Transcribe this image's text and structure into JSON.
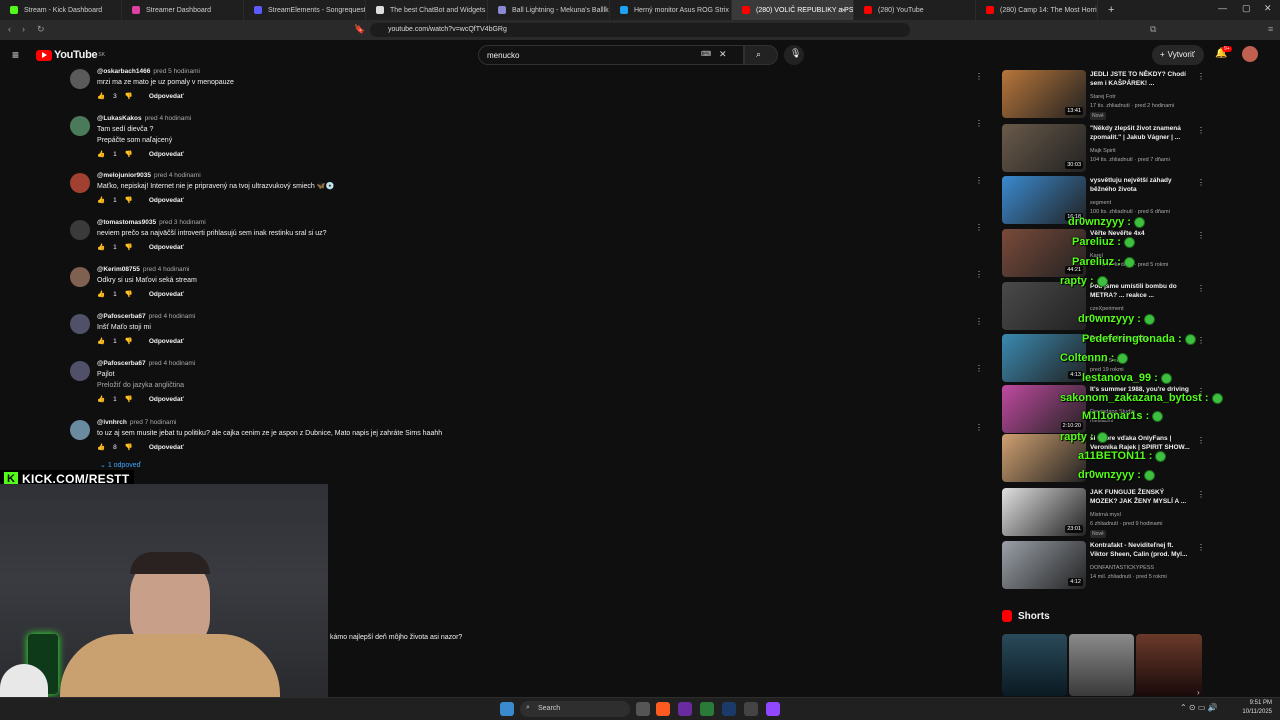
{
  "browser": {
    "tabs": [
      {
        "label": "Stream - Kick Dashboard",
        "color": "#53fc18"
      },
      {
        "label": "Streamer Dashboard",
        "color": "#e040a0"
      },
      {
        "label": "StreamElements - Songrequest",
        "color": "#5b5bff"
      },
      {
        "label": "The best ChatBot and Widgets for K",
        "color": "#dddddd"
      },
      {
        "label": "Ball Lightning - Mekuna's Balllkuna",
        "color": "#8a8ad0"
      },
      {
        "label": "Herný monitor Asus ROG Strix OLED",
        "color": "#1da1f2"
      },
      {
        "label": "(280) VOLIČ REPUBLIKY a PS-ka",
        "color": "#ff0000"
      },
      {
        "label": "(280) YouTube",
        "color": "#ff0000"
      },
      {
        "label": "(280) Camp 14: The Most Horrible Pl",
        "color": "#ff0000"
      }
    ],
    "active_tab": 6,
    "url": "youtube.com/watch?v=wcQfTV4bGRg"
  },
  "youtube": {
    "logo_text": "YouTube",
    "region": "SK",
    "search_value": "menucko",
    "create_label": "Vytvoriť",
    "notif_badge": "9+"
  },
  "comments": [
    {
      "author": "@oskarbach1466",
      "time": "pred 5 hodinami",
      "text": [
        "mrzi ma ze mato je uz pomaly v menopauze"
      ],
      "likes": "3",
      "reply": "Odpovedať",
      "avatar": "#5a5a5a"
    },
    {
      "author": "@LukasKakos",
      "time": "pred 4 hodinami",
      "text": [
        "Tam sedí dievča ?",
        "Prepáčte som naľajcený"
      ],
      "likes": "1",
      "reply": "Odpovedať",
      "avatar": "#4a7a5a"
    },
    {
      "author": "@melojunior9035",
      "time": "pred 4 hodinami",
      "text": [
        "Maťko, nepiskaj! Internet nie je pripravený na tvoj ultrazvukový smiech 🦋💿"
      ],
      "likes": "1",
      "reply": "Odpovedať",
      "avatar": "#a04030"
    },
    {
      "author": "@tomastomas9035",
      "time": "pred 3 hodinami",
      "text": [
        "neviem prečo sa najväčší introverti prihlasujú sem inak restinku sral si uz?"
      ],
      "likes": "1",
      "reply": "Odpovedať",
      "avatar": "#3a3a3a"
    },
    {
      "author": "@Kerim08755",
      "time": "pred 4 hodinami",
      "text": [
        "Odkry si usi Maťovi seká stream"
      ],
      "likes": "1",
      "reply": "Odpovedať",
      "avatar": "#806050"
    },
    {
      "author": "@Pafoscerba67",
      "time": "pred 4 hodinami",
      "text": [
        "Inšť Maťo stoji mi"
      ],
      "likes": "1",
      "reply": "Odpovedať",
      "avatar": "#505068"
    },
    {
      "author": "@Pafoscerba67",
      "time": "pred 4 hodinami",
      "text": [
        "Pajlot",
        "Preložiť do jazyka angličtina"
      ],
      "likes": "1",
      "reply": "Odpovedať",
      "avatar": "#505068"
    },
    {
      "author": "@ivnhrch",
      "time": "pred 7 hodinami",
      "text": [
        "to uz aj sem musite jebat tu politiku? ale cajka cenim ze je aspon z Dubnice, Mato napis jej zahráte Sims haahh"
      ],
      "likes": "8",
      "reply": "Odpovedať",
      "avatar": "#6a8aa0"
    }
  ],
  "replies_link": "1 odpoveď",
  "sidebar_videos": [
    {
      "title": "JEDLI JSTE TO NĚKDY? Chodí sem i KAŠPÁREK! ...",
      "channel": "Starej Fotr",
      "stats": "17 tis. zhliadnutí · pred 2 hodinami",
      "badge": "Nové",
      "duration": "13:41",
      "thumb": "#b8763a"
    },
    {
      "title": "\"Někdy zlepšit život znamená zpomalit.\" | Jakub Vágner | ...",
      "channel": "Majk Spirit",
      "stats": "104 tis. zhliadnutí · pred 7 dňami",
      "badge": "",
      "duration": "30:03",
      "thumb": "#6a5a4a"
    },
    {
      "title": "vysvětluju největší záhady běžného života",
      "channel": "segment",
      "stats": "100 tis. zhliadnutí · pred 6 dňami",
      "badge": "",
      "duration": "16:18",
      "thumb": "#3a8ad0"
    },
    {
      "title": "Věřte Nevěřte 4x4",
      "channel": "Karel",
      "stats": "414 tis. zhliadnutí · pred 5 rokmi",
      "badge": "",
      "duration": "44:21",
      "thumb": "#7a4a3a"
    },
    {
      "title": "Pod jsme umístili bombu do METRA? ... reakce ...",
      "channel": "czeXperiment",
      "stats": "mesiacmi",
      "badge": "",
      "duration": "",
      "thumb": "#4a4a4a"
    },
    {
      "title": "Pederferingtonáda",
      "channel": "Bettina Sier",
      "stats": "pred 19 rokmi",
      "badge": "",
      "duration": "4:13",
      "thumb": "#3a8ab0"
    },
    {
      "title": "It's summer 1988, you're driving",
      "channel": "Rewindapp Studio",
      "stats": "mesiacmi",
      "badge": "",
      "duration": "2:10:20",
      "thumb": "#c04aa0"
    },
    {
      "title": "si dobre vďaka OnlyFans | Veronika Rajek | SPIRIT SHOW...",
      "channel": "",
      "stats": "",
      "badge": "",
      "duration": "",
      "thumb": "#d0a070"
    },
    {
      "title": "JAK FUNGUJE ŽENSKÝ MOZEK? JAK ŽENY MYSLÍ A ...",
      "channel": "Mistrná mysl",
      "stats": "6 zhliadnutí · pred 9 hodinami",
      "badge": "Nové",
      "duration": "23:01",
      "thumb": "#e0e0e0"
    },
    {
      "title": "Kontrafakt - Neviditeľnej ft. Viktor Sheen, Calin (prod. Myl...",
      "channel": "DONFANTASTICKYPESS",
      "stats": "14 mil. zhliadnutí · pred 5 rokmi",
      "badge": "",
      "duration": "4:12",
      "thumb": "#9aa0a8"
    }
  ],
  "shorts_title": "Shorts",
  "chat_overlay": [
    {
      "text": "dr0wnzyyy :"
    },
    {
      "text": "Pareliuz :"
    },
    {
      "text": "Pareliuz :"
    },
    {
      "text": "rapty :"
    },
    {
      "text": "dr0wnzyyy :"
    },
    {
      "text": "Pedeferingtonada :"
    },
    {
      "text": "Coltennn :"
    },
    {
      "text": "lestanova_99 :"
    },
    {
      "text": "sakonom_zakazana_bytost :"
    },
    {
      "text": "M1l1onar1s :"
    },
    {
      "text": "rapty :"
    },
    {
      "text": "a11BETON11 :"
    },
    {
      "text": "dr0wnzyyy :"
    }
  ],
  "kick_label": "KICK.COM/RESTT",
  "stream_caption": "kámo najlepší deň môjho života asi nazor?",
  "taskbar": {
    "search": "Search",
    "time": "9:51 PM",
    "date": "10/11/2025"
  },
  "colors": {
    "kick_green": "#53fc18",
    "youtube_red": "#ff0000",
    "page_bg": "#0f0f0f"
  }
}
